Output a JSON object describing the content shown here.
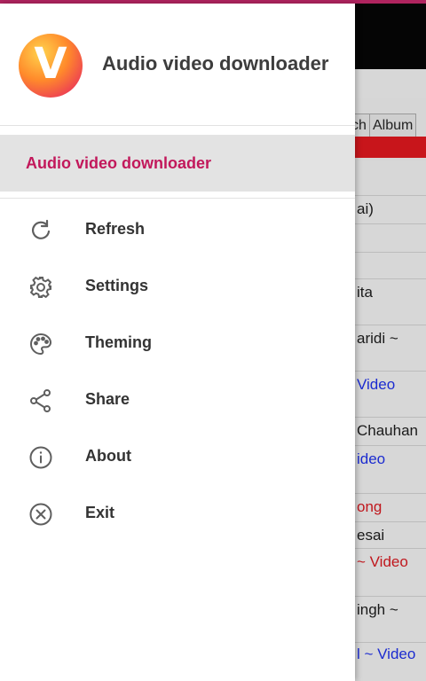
{
  "app": {
    "title": "Audio video downloader",
    "logo_text": "Audio Video Downloader"
  },
  "drawer": {
    "selected_item": "Audio video downloader",
    "items": [
      {
        "label": "Refresh",
        "icon": "refresh-icon"
      },
      {
        "label": "Settings",
        "icon": "gear-icon"
      },
      {
        "label": "Theming",
        "icon": "palette-icon"
      },
      {
        "label": "Share",
        "icon": "share-icon"
      },
      {
        "label": "About",
        "icon": "info-icon"
      },
      {
        "label": "Exit",
        "icon": "close-circle-icon"
      }
    ]
  },
  "background": {
    "tabs": [
      "ch",
      "Album"
    ],
    "rows": [
      "ai)",
      "ita",
      "aridi ~",
      "Video",
      "Chauhan",
      "ideo",
      "ong",
      "esai",
      "~ Video",
      "ingh ~",
      "l ~ Video"
    ]
  },
  "colors": {
    "accent": "#c2185b",
    "status_bar": "#b0245f",
    "link_blue": "#1b2bd0",
    "link_red": "#c0171d"
  }
}
